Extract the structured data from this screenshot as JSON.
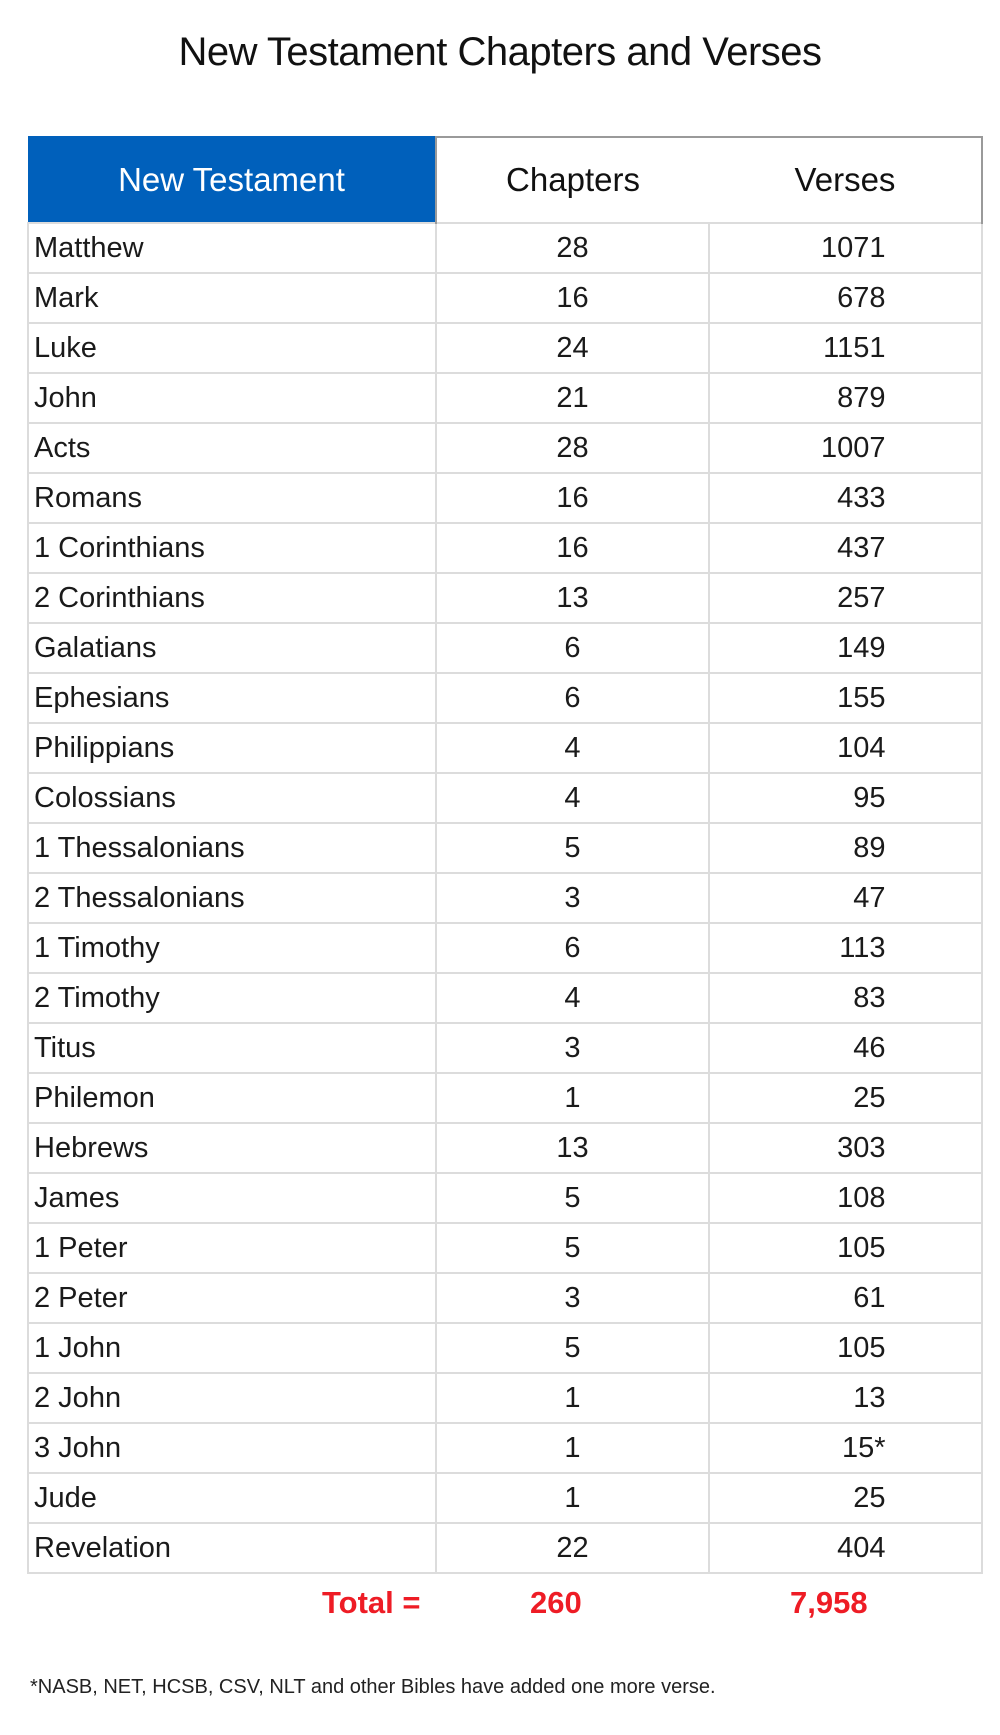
{
  "title": "New Testament Chapters and Verses",
  "table": {
    "headers": [
      "New Testament",
      "Chapters",
      "Verses"
    ],
    "header_highlight_color": "#0060bb",
    "rows": [
      {
        "book": "Matthew",
        "chapters": "28",
        "verses": "1071"
      },
      {
        "book": "Mark",
        "chapters": "16",
        "verses": "678"
      },
      {
        "book": "Luke",
        "chapters": "24",
        "verses": "1151"
      },
      {
        "book": "John",
        "chapters": "21",
        "verses": "879"
      },
      {
        "book": "Acts",
        "chapters": "28",
        "verses": "1007"
      },
      {
        "book": "Romans",
        "chapters": "16",
        "verses": "433"
      },
      {
        "book": "1 Corinthians",
        "chapters": "16",
        "verses": "437"
      },
      {
        "book": "2 Corinthians",
        "chapters": "13",
        "verses": "257"
      },
      {
        "book": "Galatians",
        "chapters": "6",
        "verses": "149"
      },
      {
        "book": "Ephesians",
        "chapters": "6",
        "verses": "155"
      },
      {
        "book": "Philippians",
        "chapters": "4",
        "verses": "104"
      },
      {
        "book": "Colossians",
        "chapters": "4",
        "verses": "95"
      },
      {
        "book": "1 Thessalonians",
        "chapters": "5",
        "verses": "89"
      },
      {
        "book": "2 Thessalonians",
        "chapters": "3",
        "verses": "47"
      },
      {
        "book": "1 Timothy",
        "chapters": "6",
        "verses": "113"
      },
      {
        "book": "2 Timothy",
        "chapters": "4",
        "verses": "83"
      },
      {
        "book": "Titus",
        "chapters": "3",
        "verses": "46"
      },
      {
        "book": "Philemon",
        "chapters": "1",
        "verses": "25"
      },
      {
        "book": "Hebrews",
        "chapters": "13",
        "verses": "303"
      },
      {
        "book": "James",
        "chapters": "5",
        "verses": "108"
      },
      {
        "book": "1 Peter",
        "chapters": "5",
        "verses": "105"
      },
      {
        "book": "2 Peter",
        "chapters": "3",
        "verses": "61"
      },
      {
        "book": "1 John",
        "chapters": "5",
        "verses": "105"
      },
      {
        "book": "2 John",
        "chapters": "1",
        "verses": "13"
      },
      {
        "book": "3 John",
        "chapters": "1",
        "verses": "15*"
      },
      {
        "book": "Jude",
        "chapters": "1",
        "verses": "25"
      },
      {
        "book": "Revelation",
        "chapters": "22",
        "verses": "404"
      }
    ]
  },
  "totals": {
    "label": "Total =",
    "chapters": "260",
    "verses": "7,958",
    "color": "#ee1c25"
  },
  "footnote": "*NASB, NET, HCSB, CSV, NLT and other Bibles have added one more verse."
}
